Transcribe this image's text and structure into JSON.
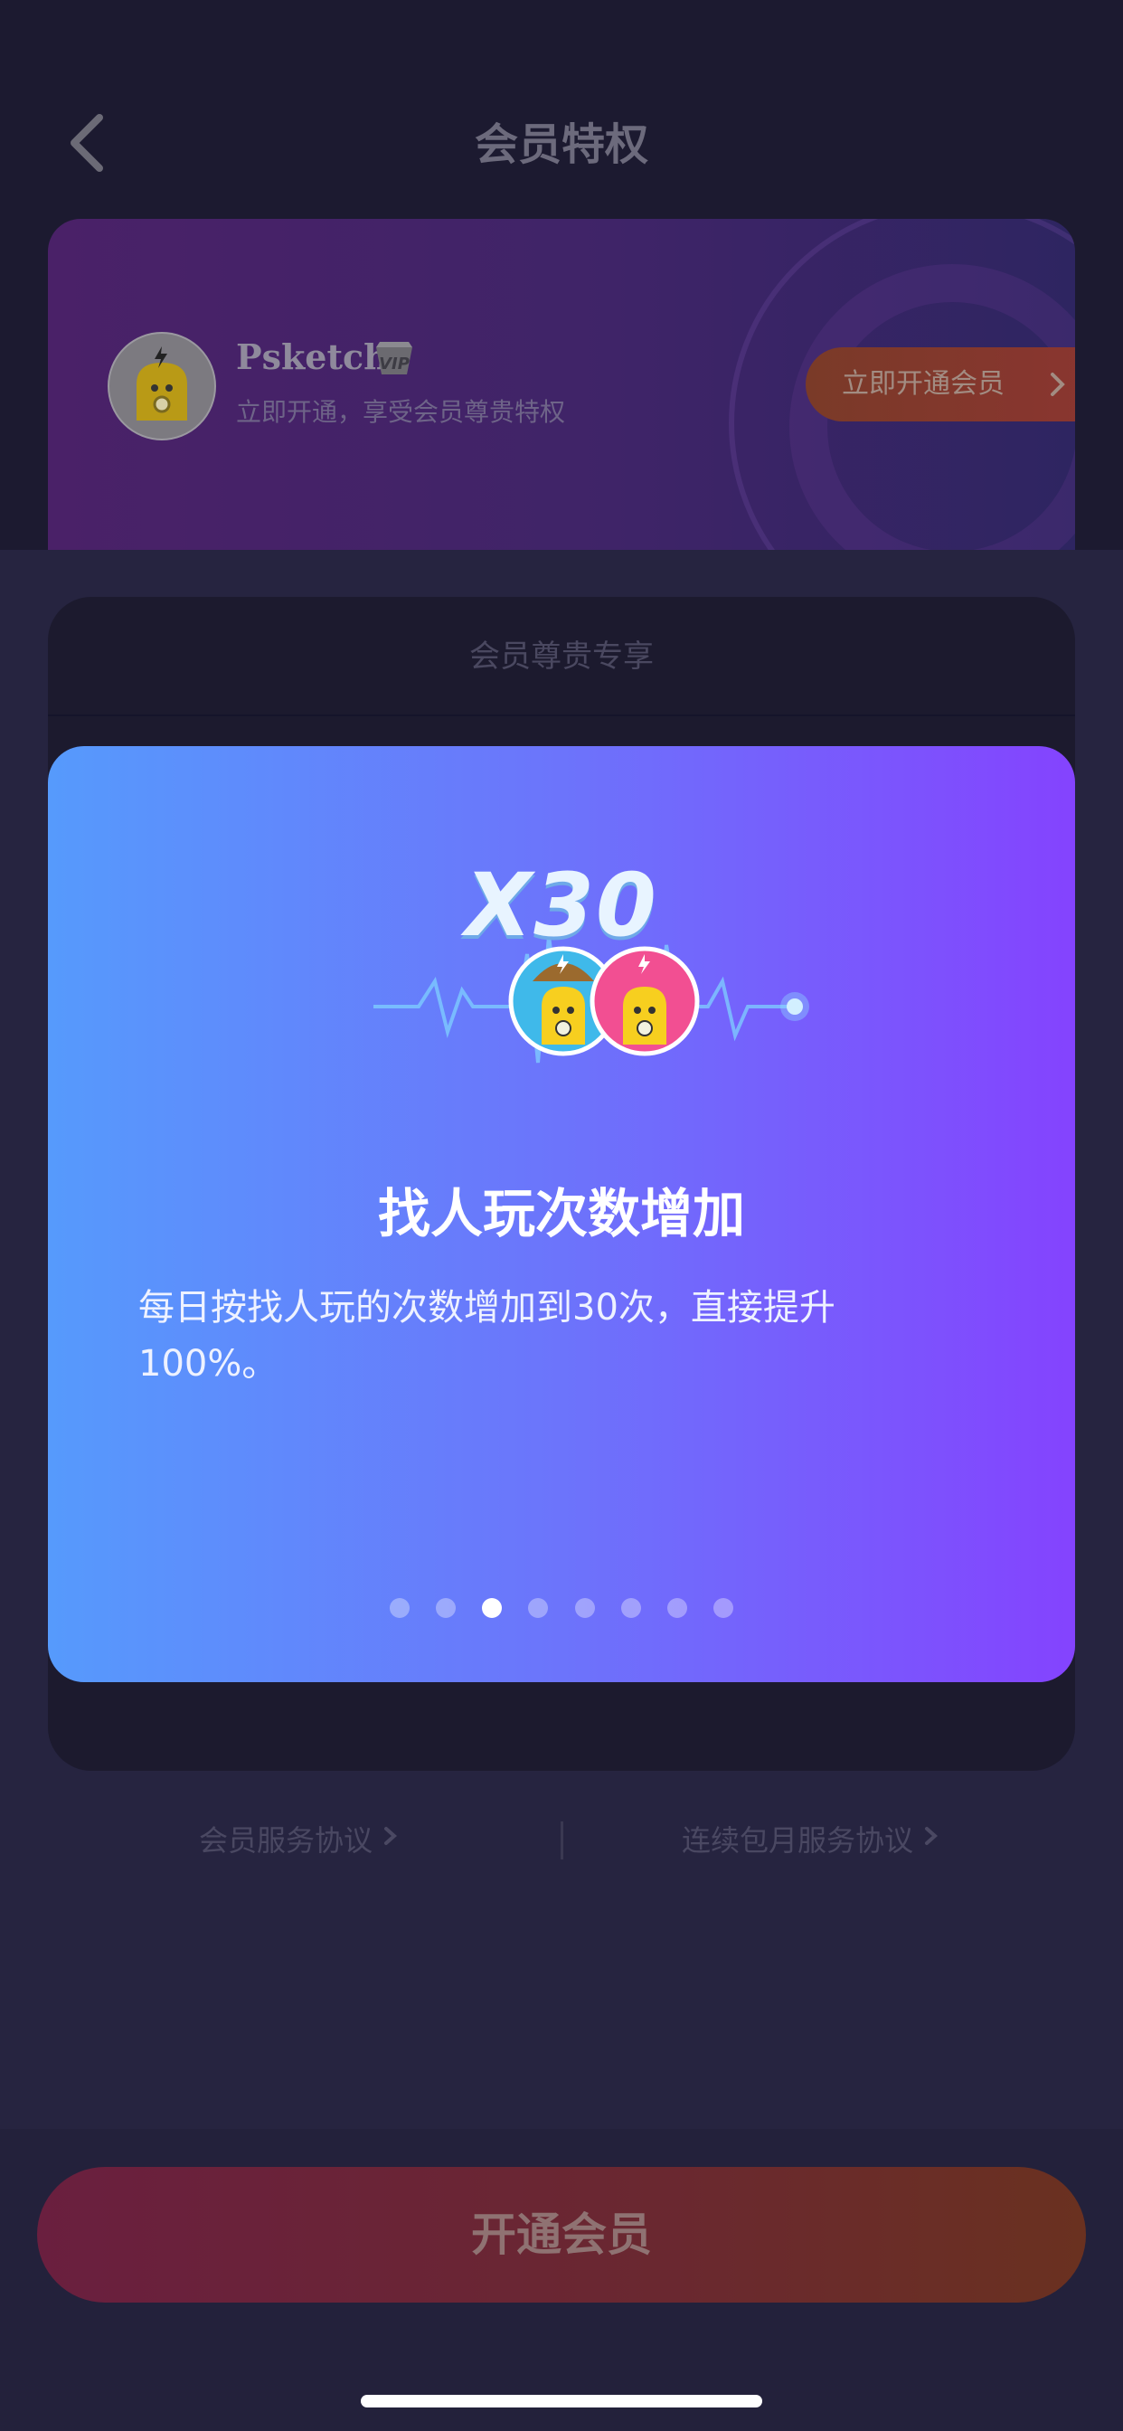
{
  "nav": {
    "title": "会员特权"
  },
  "vip_card": {
    "username": "Psketch",
    "badge": "VIP",
    "subtitle": "立即开通，享受会员尊贵特权",
    "open_button": "立即开通会员"
  },
  "panel": {
    "title": "会员尊贵专享"
  },
  "modal": {
    "multiplier": "X30",
    "title": "找人玩次数增加",
    "description": "每日按找人玩的次数增加到30次，直接提升100%。",
    "page_count": 8,
    "active_page": 3
  },
  "links": {
    "member_service": "会员服务协议",
    "auto_renew_service": "连续包月服务协议"
  },
  "cta": {
    "label": "开通会员"
  },
  "colors": {
    "modal_start": "#569afc",
    "modal_end": "#8443fe"
  }
}
